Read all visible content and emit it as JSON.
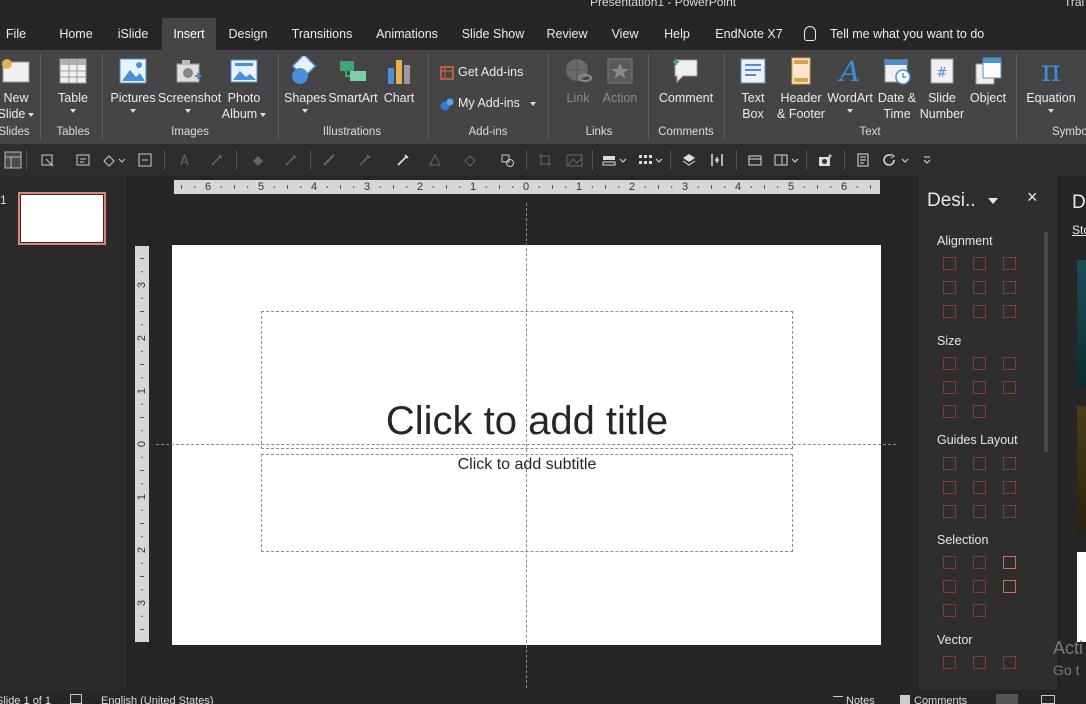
{
  "window": {
    "title": "Presentation1  -  PowerPoint",
    "user": "Trai"
  },
  "tabs": [
    {
      "label": "File"
    },
    {
      "label": "Home"
    },
    {
      "label": "iSlide"
    },
    {
      "label": "Insert",
      "active": true
    },
    {
      "label": "Design"
    },
    {
      "label": "Transitions"
    },
    {
      "label": "Animations"
    },
    {
      "label": "Slide Show"
    },
    {
      "label": "Review"
    },
    {
      "label": "View"
    },
    {
      "label": "Help"
    },
    {
      "label": "EndNote X7"
    }
  ],
  "tell_me": "Tell me what you want to do",
  "ribbon": {
    "new_slide": {
      "l1": "New",
      "l2": "Slide"
    },
    "table": "Table",
    "pictures": "Pictures",
    "screenshot": "Screenshot",
    "photo_album": {
      "l1": "Photo",
      "l2": "Album"
    },
    "shapes": "Shapes",
    "smartart": "SmartArt",
    "chart": "Chart",
    "get_addins": "Get Add-ins",
    "my_addins": "My Add-ins",
    "link": "Link",
    "action": "Action",
    "comment": "Comment",
    "text_box": {
      "l1": "Text",
      "l2": "Box"
    },
    "header_footer": {
      "l1": "Header",
      "l2": "& Footer"
    },
    "wordart": "WordArt",
    "date_time": {
      "l1": "Date &",
      "l2": "Time"
    },
    "slide_number": {
      "l1": "Slide",
      "l2": "Number"
    },
    "object": "Object",
    "equation": "Equation",
    "groups": {
      "slides": "Slides",
      "tables": "Tables",
      "images": "Images",
      "illustrations": "Illustrations",
      "addins": "Add-ins",
      "links": "Links",
      "comments": "Comments",
      "text": "Text",
      "symbols": "Symbo"
    }
  },
  "thumbnails": {
    "slide_number": "1"
  },
  "slide": {
    "title_placeholder": "Click to add title",
    "subtitle_placeholder": "Click to add subtitle"
  },
  "rulers": {
    "horizontal": [
      "6",
      "5",
      "4",
      "3",
      "2",
      "1",
      "0",
      "1",
      "2",
      "3",
      "4",
      "5",
      "6"
    ],
    "vertical": [
      "3",
      "2",
      "1",
      "0",
      "1",
      "2",
      "3"
    ]
  },
  "design_pane": {
    "title": "Desi..",
    "close": "×",
    "sections": [
      "Alignment",
      "Size",
      "Guides Layout",
      "Selection",
      "Vector"
    ]
  },
  "far_pane": {
    "title": "D",
    "link": "Sto"
  },
  "watermark": {
    "line1": "Acti",
    "line2": "Go t"
  },
  "status": {
    "slide": "Slide 1 of 1",
    "language": "English (United States)",
    "notes": "Notes",
    "comments": "Comments"
  },
  "colors": {
    "ribbon": "#454545",
    "background": "#262626",
    "accent": "#e8836f",
    "design_icon": "#8b3a33"
  }
}
